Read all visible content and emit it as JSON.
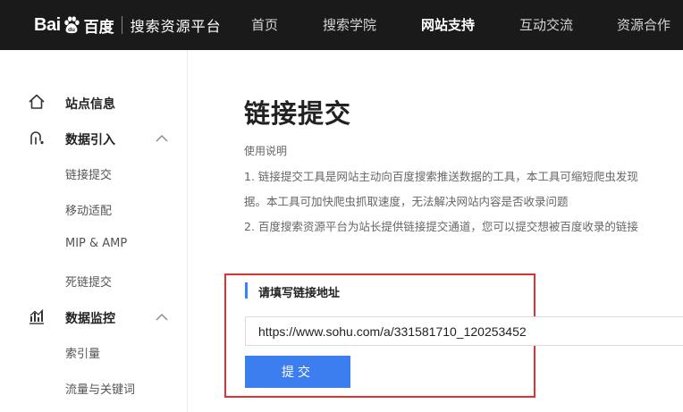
{
  "header": {
    "logo": {
      "bai": "Bai",
      "du": "du",
      "cn": "百度",
      "subtitle": "搜索资源平台"
    },
    "nav": [
      "首页",
      "搜索学院",
      "网站支持",
      "互动交流",
      "资源合作"
    ],
    "active_nav": "网站支持"
  },
  "sidebar": {
    "site_info": "站点信息",
    "data_import": {
      "label": "数据引入",
      "items": [
        "链接提交",
        "移动适配",
        "MIP & AMP",
        "死链提交"
      ]
    },
    "data_monitor": {
      "label": "数据监控",
      "items": [
        "索引量",
        "流量与关键词"
      ]
    }
  },
  "main": {
    "title": "链接提交",
    "instructions_title": "使用说明",
    "instructions": [
      "1. 链接提交工具是网站主动向百度搜索推送数据的工具，本工具可缩短爬虫发现",
      "据。本工具可加快爬虫抓取速度，无法解决网站内容是否收录问题",
      "2. 百度搜索资源平台为站长提供链接提交通道，您可以提交想被百度收录的链接"
    ],
    "form": {
      "section_label": "请填写链接地址",
      "url_value": "https://www.sohu.com/a/331581710_120253452",
      "submit_label": "提交"
    }
  },
  "colors": {
    "topbar": "#1a1a1a",
    "accent": "#3c7ef0",
    "highlight_box": "#e03131"
  }
}
